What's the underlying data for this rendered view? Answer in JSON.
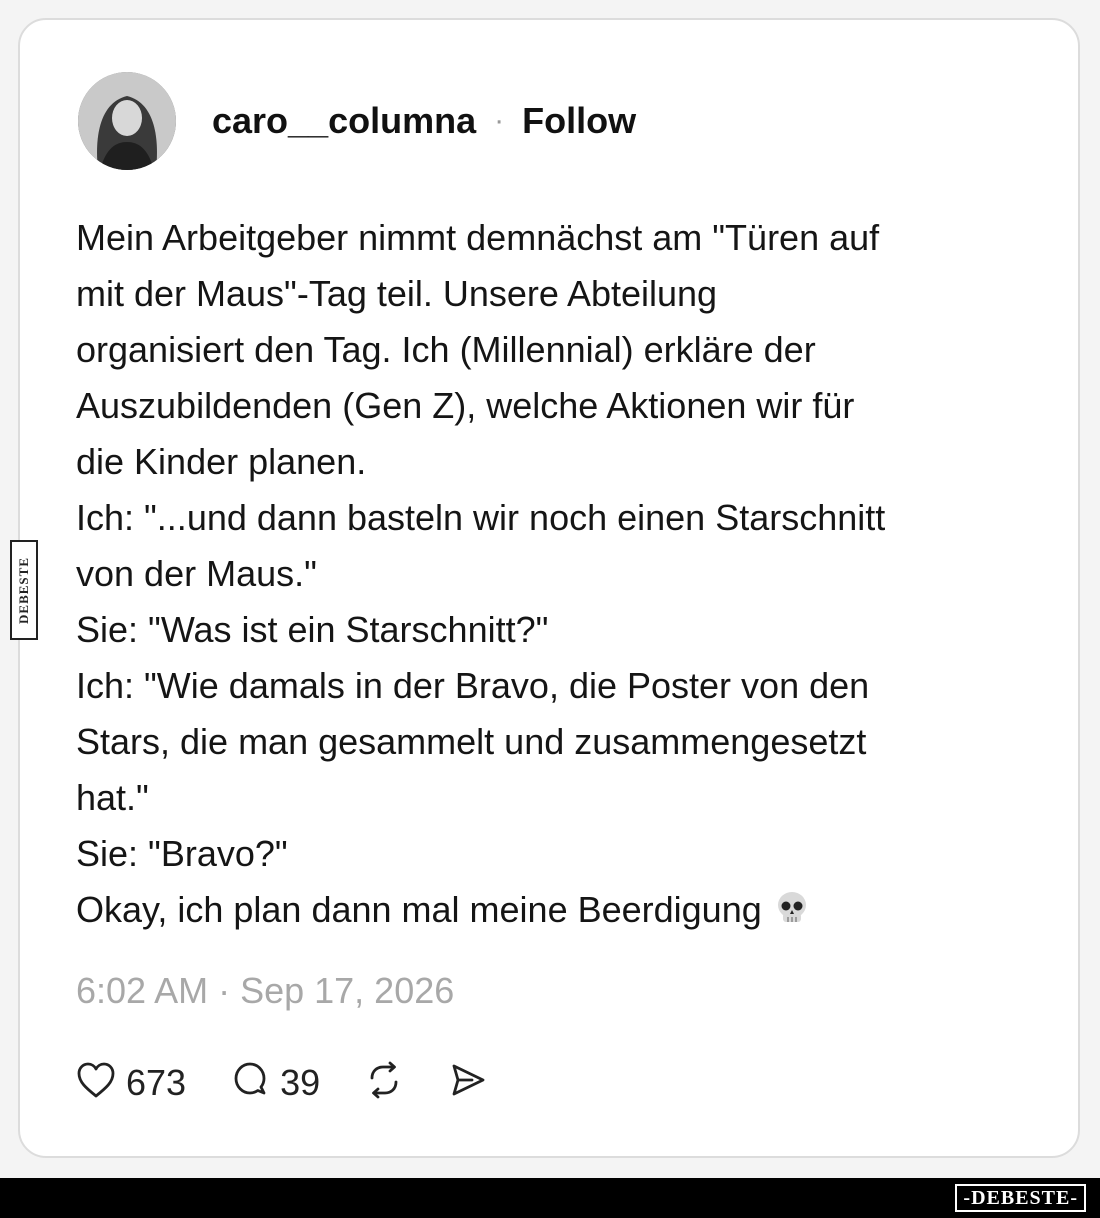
{
  "post": {
    "username": "caro__columna",
    "separator": "·",
    "follow_label": "Follow",
    "lines": [
      "Mein Arbeitgeber nimmt demnächst am \"Türen auf",
      "mit der Maus\"-Tag teil. Unsere Abteilung",
      "organisiert den Tag. Ich (Millennial) erkläre der",
      "Auszubildenden (Gen Z), welche Aktionen wir für",
      "die Kinder planen.",
      "Ich: \"...und dann basteln wir noch einen Starschnitt",
      "von der Maus.\"",
      "Sie: \"Was ist ein Starschnitt?\"",
      "Ich: \"Wie damals in der Bravo, die Poster von den",
      "Stars, die man gesammelt und zusammengesetzt",
      "hat.\"",
      "Sie: \"Bravo?\"",
      "Okay, ich plan dann mal meine Beerdigung"
    ],
    "emoji": "skull-emoji",
    "timestamp": "6:02 AM · Sep 17, 2026"
  },
  "actions": {
    "likes": "673",
    "replies": "39",
    "icons": [
      "heart-icon",
      "comment-icon",
      "repost-icon",
      "share-icon"
    ]
  },
  "watermark": {
    "side_text": "DEBESTE",
    "footer_text": "-DEBESTE-"
  },
  "colors": {
    "text": "#151515",
    "muted": "#a8a8a8",
    "card_border": "#dcdcdc"
  }
}
